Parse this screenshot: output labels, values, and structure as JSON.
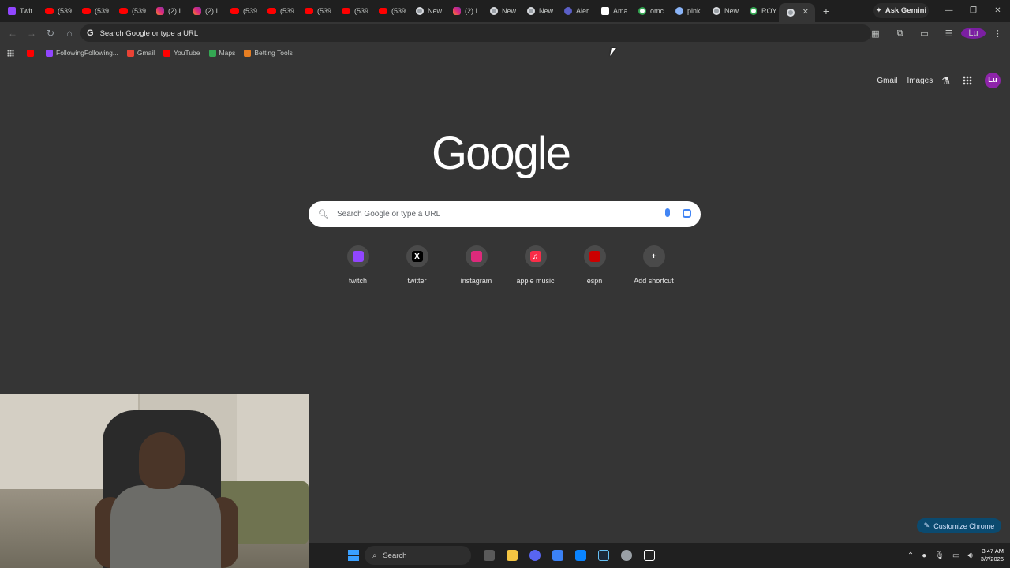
{
  "tabs": [
    {
      "label": "Twit",
      "icon": "twitch-icon",
      "cls": "ico-twitch"
    },
    {
      "label": "(539",
      "icon": "youtube-icon",
      "cls": "ico-yt"
    },
    {
      "label": "(539",
      "icon": "youtube-icon",
      "cls": "ico-yt"
    },
    {
      "label": "(539",
      "icon": "youtube-icon",
      "cls": "ico-yt"
    },
    {
      "label": "(2) I",
      "icon": "instagram-icon",
      "cls": "ico-ig"
    },
    {
      "label": "(2) I",
      "icon": "instagram-icon",
      "cls": "ico-ig"
    },
    {
      "label": "(539",
      "icon": "youtube-icon",
      "cls": "ico-yt"
    },
    {
      "label": "(539",
      "icon": "youtube-icon",
      "cls": "ico-yt"
    },
    {
      "label": "(539",
      "icon": "youtube-icon",
      "cls": "ico-yt"
    },
    {
      "label": "(539",
      "icon": "youtube-icon",
      "cls": "ico-yt"
    },
    {
      "label": "(539",
      "icon": "youtube-icon",
      "cls": "ico-yt"
    },
    {
      "label": "New",
      "icon": "chrome-icon",
      "cls": "ico-chrome"
    },
    {
      "label": "(2) I",
      "icon": "instagram-icon",
      "cls": "ico-ig"
    },
    {
      "label": "New",
      "icon": "chrome-icon",
      "cls": "ico-chrome"
    },
    {
      "label": "New",
      "icon": "chrome-icon",
      "cls": "ico-chrome"
    },
    {
      "label": "Aler",
      "icon": "alert-icon",
      "cls": "ico-alert"
    },
    {
      "label": "Ama",
      "icon": "amazon-icon",
      "cls": "ico-amazon"
    },
    {
      "label": "omc",
      "icon": "google-icon",
      "cls": "ico-google"
    },
    {
      "label": "pink",
      "icon": "pink-icon",
      "cls": "ico-pink"
    },
    {
      "label": "New",
      "icon": "chrome-icon",
      "cls": "ico-chrome"
    },
    {
      "label": "ROY",
      "icon": "google-icon",
      "cls": "ico-google"
    }
  ],
  "ask_gemini": "Ask Gemini",
  "omnibox": {
    "placeholder": "Search Google or type a URL"
  },
  "bookmarks": [
    {
      "label": "",
      "icon": "youtube-icon",
      "color": "#ff0000"
    },
    {
      "label": "FollowingFollowing...",
      "icon": "twitch-icon",
      "color": "#9146ff"
    },
    {
      "label": "Gmail",
      "icon": "gmail-icon",
      "color": "#ea4335"
    },
    {
      "label": "YouTube",
      "icon": "youtube-icon",
      "color": "#ff0000"
    },
    {
      "label": "Maps",
      "icon": "maps-icon",
      "color": "#34a853"
    },
    {
      "label": "Betting Tools",
      "icon": "betting-icon",
      "color": "#e67e22"
    }
  ],
  "toplinks": {
    "gmail": "Gmail",
    "images": "Images",
    "avatar": "Lu"
  },
  "logo": "Google",
  "search": {
    "placeholder": "Search Google or type a URL"
  },
  "shortcuts": [
    {
      "label": "twitch",
      "icon": "twitch-icon",
      "color": "#9146ff",
      "glyph": ""
    },
    {
      "label": "twitter",
      "icon": "x-icon",
      "color": "#000000",
      "glyph": "X"
    },
    {
      "label": "instagram",
      "icon": "instagram-icon",
      "color": "#dd2a7b",
      "glyph": ""
    },
    {
      "label": "apple music",
      "icon": "apple-music-icon",
      "color": "#fa2d48",
      "glyph": "♫"
    },
    {
      "label": "espn",
      "icon": "espn-icon",
      "color": "#cc0000",
      "glyph": ""
    },
    {
      "label": "Add shortcut",
      "icon": "plus-icon",
      "color": "#4a4a4a",
      "glyph": "+"
    }
  ],
  "customize": "Customize Chrome",
  "taskbar": {
    "search": "Search",
    "time": "3:47 AM",
    "date": "3/7/2026"
  },
  "profile_mini": "Lu"
}
